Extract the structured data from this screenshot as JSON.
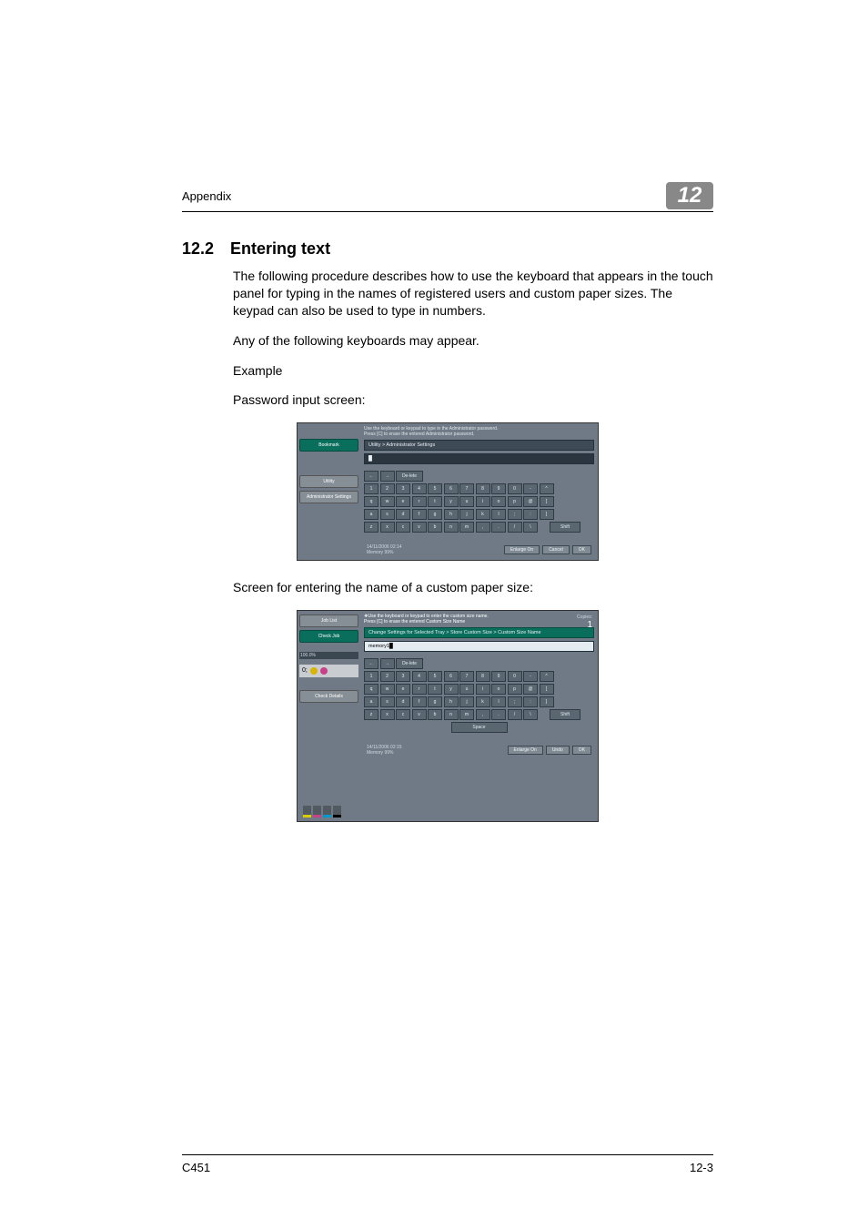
{
  "header": {
    "label": "Appendix",
    "chapter": "12"
  },
  "section": {
    "number": "12.2",
    "title": "Entering text"
  },
  "paragraphs": {
    "p1": "The following procedure describes how to use the keyboard that appears in the touch panel for typing in the names of registered users and custom paper sizes. The keypad can also be used to type in numbers.",
    "p2": "Any of the following keyboards may appear.",
    "p3": "Example",
    "p4": "Password input screen:",
    "p5": "Screen for entering the name of a custom paper size:"
  },
  "screenshot1": {
    "sidebar": {
      "bookmark": "Bookmark",
      "utility": "Utility",
      "admin": "Administrator Settings"
    },
    "instr_line1": "Use the keyboard or keypad to type in the Administrator password.",
    "instr_line2": "Press [C] to erase the entered Administrator password.",
    "breadcrumb": "Utility > Administrator Settings",
    "typed": "█",
    "keys_r1": [
      "←",
      "→",
      "De-lete"
    ],
    "keys_num": [
      "1",
      "2",
      "3",
      "4",
      "5",
      "6",
      "7",
      "8",
      "9",
      "0",
      "-",
      "^"
    ],
    "keys_q": [
      "q",
      "w",
      "e",
      "r",
      "t",
      "y",
      "u",
      "i",
      "o",
      "p",
      "@",
      "["
    ],
    "keys_a": [
      "a",
      "s",
      "d",
      "f",
      "g",
      "h",
      "j",
      "k",
      "l",
      ";",
      ":",
      "]"
    ],
    "keys_z": [
      "z",
      "x",
      "c",
      "v",
      "b",
      "n",
      "m",
      ",",
      ".",
      "/",
      "\\"
    ],
    "shift": "Shift",
    "datetime": "14/11/2006   02:14",
    "memory": "Memory        99%",
    "enlarge": "Enlarge On",
    "cancel": "Cancel",
    "ok": "OK"
  },
  "screenshot2": {
    "sidebar": {
      "joblist": "Job List",
      "checkjob": "Check Job",
      "checkdetails": "Check Details"
    },
    "copies_label": "Copies:",
    "copies_value": "1",
    "status_pct": "100.0%",
    "instr_line1": "❖Use the keyboard or keypad to enter the custom size name.",
    "instr_line2": "Press [C] to erase the entered Custom Size Name",
    "breadcrumb": "Change Settings for Selected Tray > Store Custom Size > Custom Size Name",
    "typed": "memory1█",
    "keys_r1": [
      "←",
      "→",
      "De-lete"
    ],
    "keys_num": [
      "1",
      "2",
      "3",
      "4",
      "5",
      "6",
      "7",
      "8",
      "9",
      "0",
      "-",
      "^"
    ],
    "keys_q": [
      "q",
      "w",
      "e",
      "r",
      "t",
      "y",
      "u",
      "i",
      "o",
      "p",
      "@",
      "["
    ],
    "keys_a": [
      "a",
      "s",
      "d",
      "f",
      "g",
      "h",
      "j",
      "k",
      "l",
      ";",
      ":",
      "]"
    ],
    "keys_z": [
      "z",
      "x",
      "c",
      "v",
      "b",
      "n",
      "m",
      ",",
      ".",
      "/",
      "\\"
    ],
    "shift": "Shift",
    "space": "Space",
    "datetime": "14/11/2006   02:15",
    "memory": "Memory        99%",
    "enlarge": "Enlarge On",
    "undo": "Undo",
    "ok": "OK"
  },
  "footer": {
    "left": "C451",
    "right": "12-3"
  }
}
